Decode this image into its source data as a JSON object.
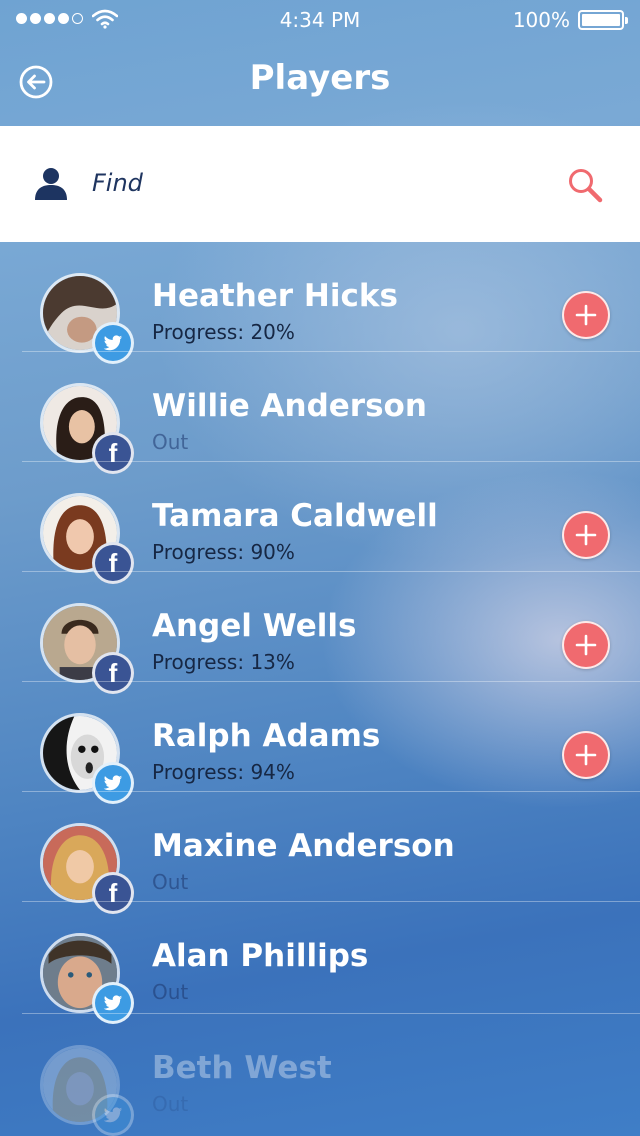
{
  "status_bar": {
    "time": "4:34 PM",
    "battery": "100%"
  },
  "nav": {
    "title": "Players"
  },
  "search": {
    "placeholder": "Find"
  },
  "colors": {
    "accent_add": "#f06a6f",
    "twitter": "#3d9be3",
    "facebook": "#3a5494",
    "search_icon": "#f06a6f"
  },
  "players": [
    {
      "name": "Heather Hicks",
      "status": "Progress: 20%",
      "network": "twitter",
      "can_add": true
    },
    {
      "name": "Willie Anderson",
      "status": "Out",
      "network": "facebook",
      "can_add": false
    },
    {
      "name": "Tamara Caldwell",
      "status": "Progress: 90%",
      "network": "facebook",
      "can_add": true
    },
    {
      "name": "Angel Wells",
      "status": "Progress: 13%",
      "network": "facebook",
      "can_add": true
    },
    {
      "name": "Ralph Adams",
      "status": "Progress: 94%",
      "network": "twitter",
      "can_add": true
    },
    {
      "name": "Maxine Anderson",
      "status": "Out",
      "network": "facebook",
      "can_add": false
    },
    {
      "name": "Alan Phillips",
      "status": "Out",
      "network": "twitter",
      "can_add": false
    },
    {
      "name": "Beth West",
      "status": "Out",
      "network": "twitter",
      "can_add": false
    }
  ],
  "icons": {
    "back": "back-arrow-circle-icon",
    "person": "person-icon",
    "search": "search-icon",
    "add": "plus-circle-icon",
    "twitter": "twitter-bird-icon",
    "facebook": "facebook-f-icon"
  }
}
